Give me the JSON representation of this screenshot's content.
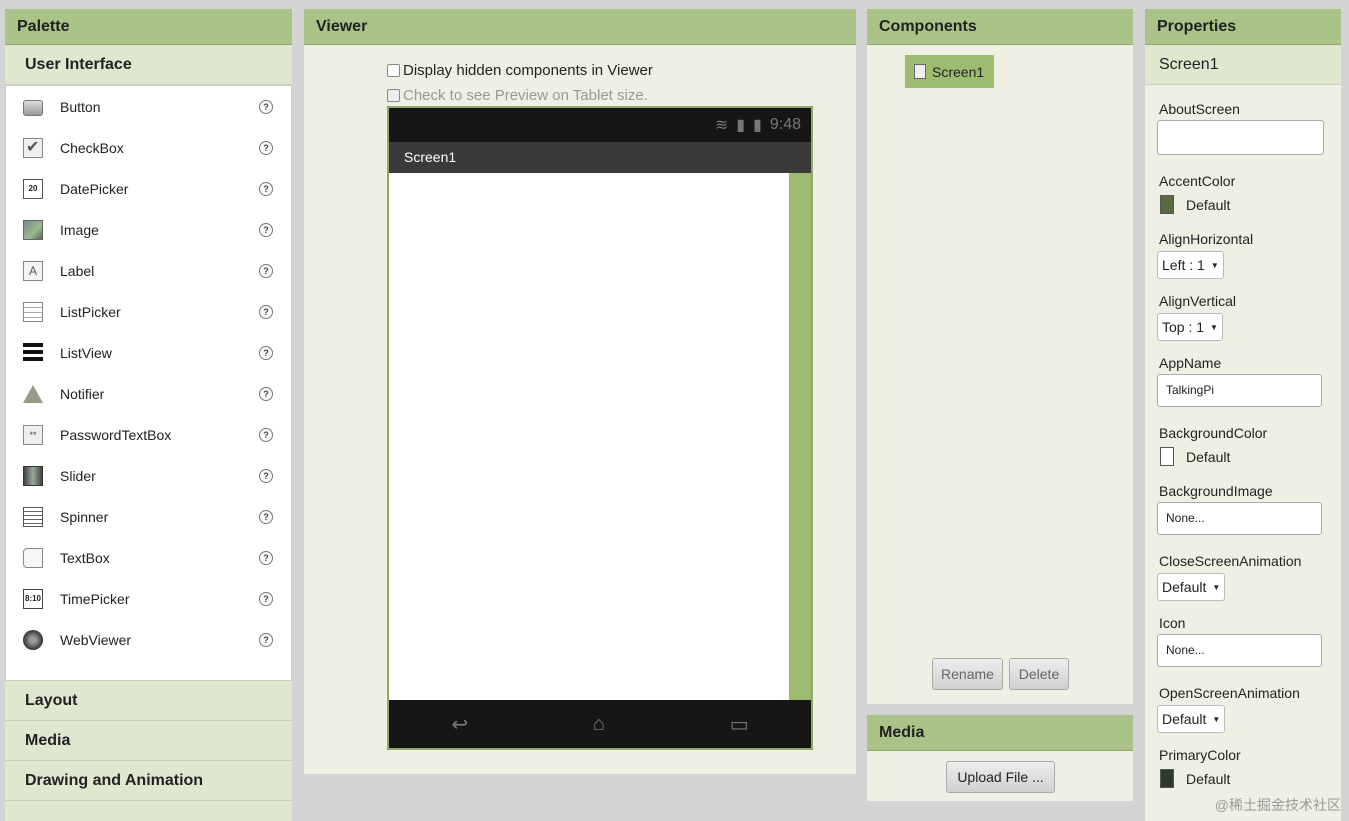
{
  "palette": {
    "title": "Palette",
    "category_open": "User Interface",
    "items": [
      {
        "label": "Button",
        "icon": "button-icon"
      },
      {
        "label": "CheckBox",
        "icon": "checkbox-icon"
      },
      {
        "label": "DatePicker",
        "icon": "datepicker-icon"
      },
      {
        "label": "Image",
        "icon": "image-icon"
      },
      {
        "label": "Label",
        "icon": "label-icon"
      },
      {
        "label": "ListPicker",
        "icon": "listpicker-icon"
      },
      {
        "label": "ListView",
        "icon": "listview-icon"
      },
      {
        "label": "Notifier",
        "icon": "notifier-icon"
      },
      {
        "label": "PasswordTextBox",
        "icon": "password-icon"
      },
      {
        "label": "Slider",
        "icon": "slider-icon"
      },
      {
        "label": "Spinner",
        "icon": "spinner-icon"
      },
      {
        "label": "TextBox",
        "icon": "textbox-icon"
      },
      {
        "label": "TimePicker",
        "icon": "timepicker-icon"
      },
      {
        "label": "WebViewer",
        "icon": "webviewer-icon"
      }
    ],
    "help_glyph": "?",
    "date_icon_text": "20",
    "label_icon_text": "A",
    "password_icon_text": "**",
    "time_icon_text": "8:10",
    "other_categories": [
      "Layout",
      "Media",
      "Drawing and Animation"
    ]
  },
  "viewer": {
    "title": "Viewer",
    "check_hidden": "Display hidden components in Viewer",
    "check_tablet": "Check to see Preview on Tablet size.",
    "status_time": "9:48",
    "screen_title": "Screen1",
    "nav_back": "↩",
    "nav_home": "⌂",
    "nav_recent": "▭"
  },
  "components": {
    "title": "Components",
    "tree_root": "Screen1",
    "rename_label": "Rename",
    "delete_label": "Delete"
  },
  "media": {
    "title": "Media",
    "upload_label": "Upload File ..."
  },
  "properties": {
    "title": "Properties",
    "component": "Screen1",
    "about_screen": {
      "label": "AboutScreen",
      "value": ""
    },
    "accent_color": {
      "label": "AccentColor",
      "value": "Default",
      "swatch": "#5a6b43"
    },
    "align_horizontal": {
      "label": "AlignHorizontal",
      "value": "Left : 1"
    },
    "align_vertical": {
      "label": "AlignVertical",
      "value": "Top : 1"
    },
    "app_name": {
      "label": "AppName",
      "value": "TalkingPi"
    },
    "background_color": {
      "label": "BackgroundColor",
      "value": "Default",
      "swatch": "#ffffff"
    },
    "background_image": {
      "label": "BackgroundImage",
      "value": "None..."
    },
    "close_anim": {
      "label": "CloseScreenAnimation",
      "value": "Default"
    },
    "icon": {
      "label": "Icon",
      "value": "None..."
    },
    "open_anim": {
      "label": "OpenScreenAnimation",
      "value": "Default"
    },
    "primary_color": {
      "label": "PrimaryColor",
      "value": "Default",
      "swatch": "#2b3a2b"
    },
    "select_arrow": "▼"
  },
  "watermark": "@稀土掘金技术社区",
  "colors": {
    "header": "#a9c388",
    "accent": "#9dbc70",
    "panel": "#eef0e4"
  }
}
